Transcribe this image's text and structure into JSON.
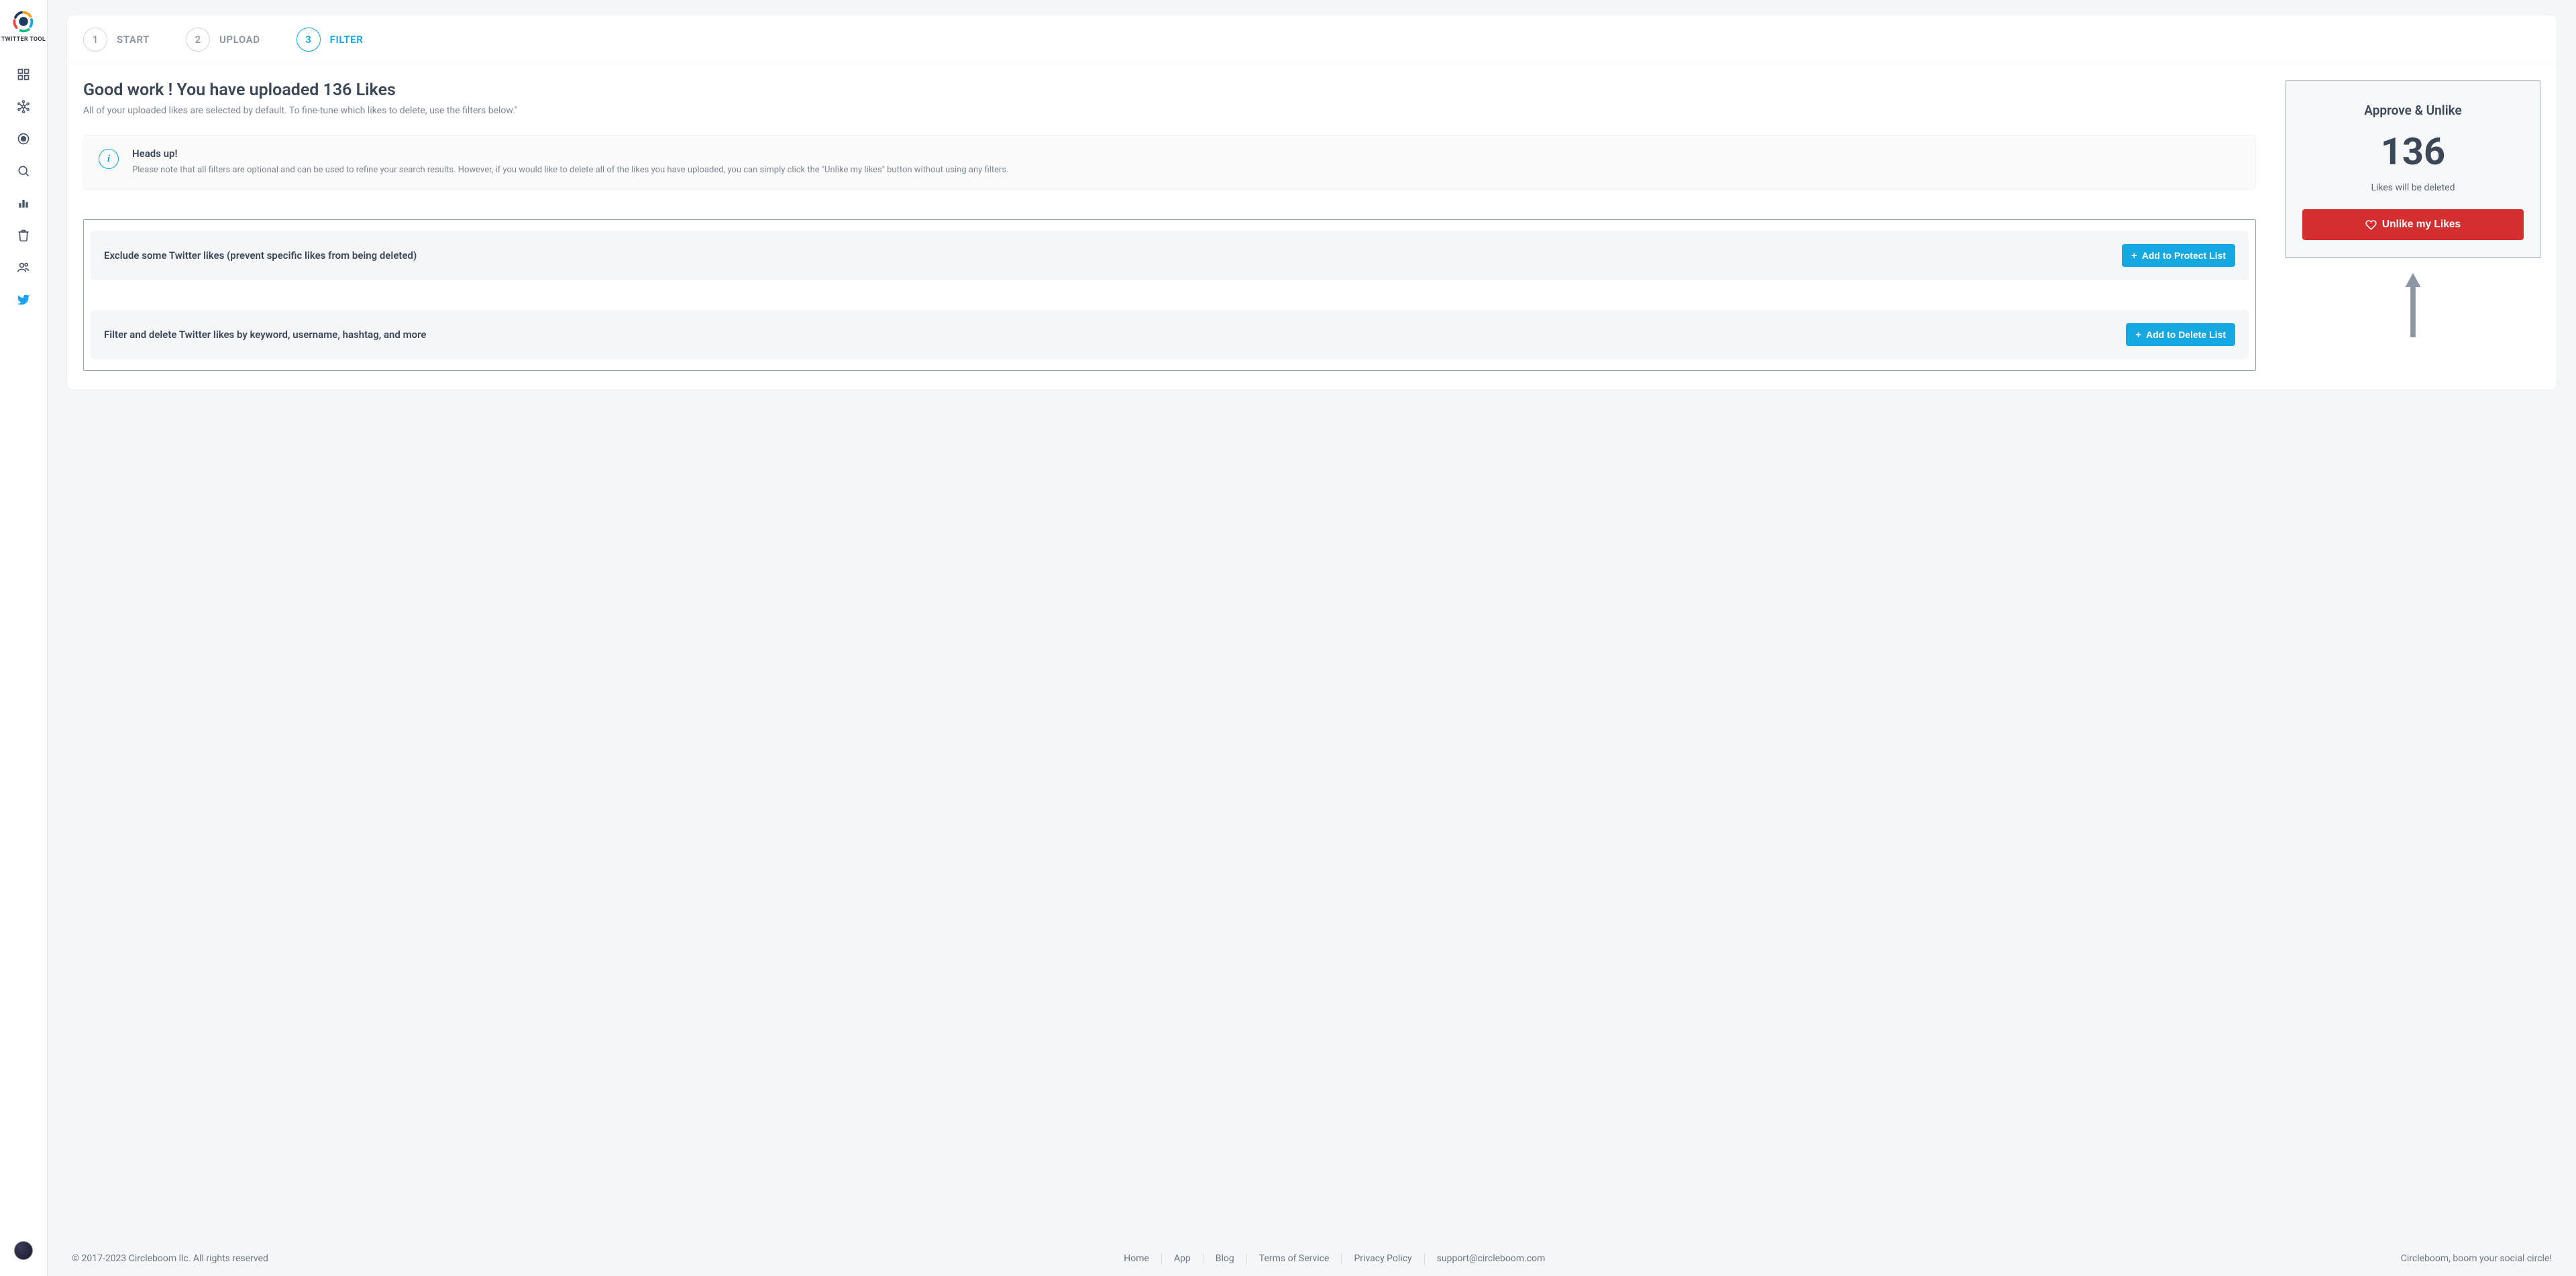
{
  "brand": {
    "name": "TWITTER TOOL"
  },
  "stepper": {
    "steps": [
      {
        "num": "1",
        "label": "START"
      },
      {
        "num": "2",
        "label": "UPLOAD"
      },
      {
        "num": "3",
        "label": "FILTER"
      }
    ]
  },
  "heading": "Good work ! You have uploaded 136 Likes",
  "subheading": "All of your uploaded likes are selected by default. To fine-tune which likes to delete, use the filters below.\"",
  "alert": {
    "title": "Heads up!",
    "body": "Please note that all filters are optional and can be used to refine your search results. However, if you would like to delete all of the likes you have uploaded, you can simply click the \"Unlike my likes\" button without using any filters."
  },
  "filters": {
    "protect": {
      "label": "Exclude some Twitter likes (prevent specific likes from being deleted)",
      "button": "Add to Protect List"
    },
    "delete": {
      "label": "Filter and delete Twitter likes by keyword, username, hashtag, and more",
      "button": "Add to Delete List"
    }
  },
  "approve": {
    "title": "Approve & Unlike",
    "count": "136",
    "subtitle": "Likes will be deleted",
    "button": "Unlike my Likes"
  },
  "footer": {
    "copyright": "© 2017-2023 Circleboom llc. All rights reserved",
    "links": {
      "home": "Home",
      "app": "App",
      "blog": "Blog",
      "tos": "Terms of Service",
      "privacy": "Privacy Policy",
      "support": "support@circleboom.com"
    },
    "tagline": "Circleboom, boom your social circle!"
  }
}
